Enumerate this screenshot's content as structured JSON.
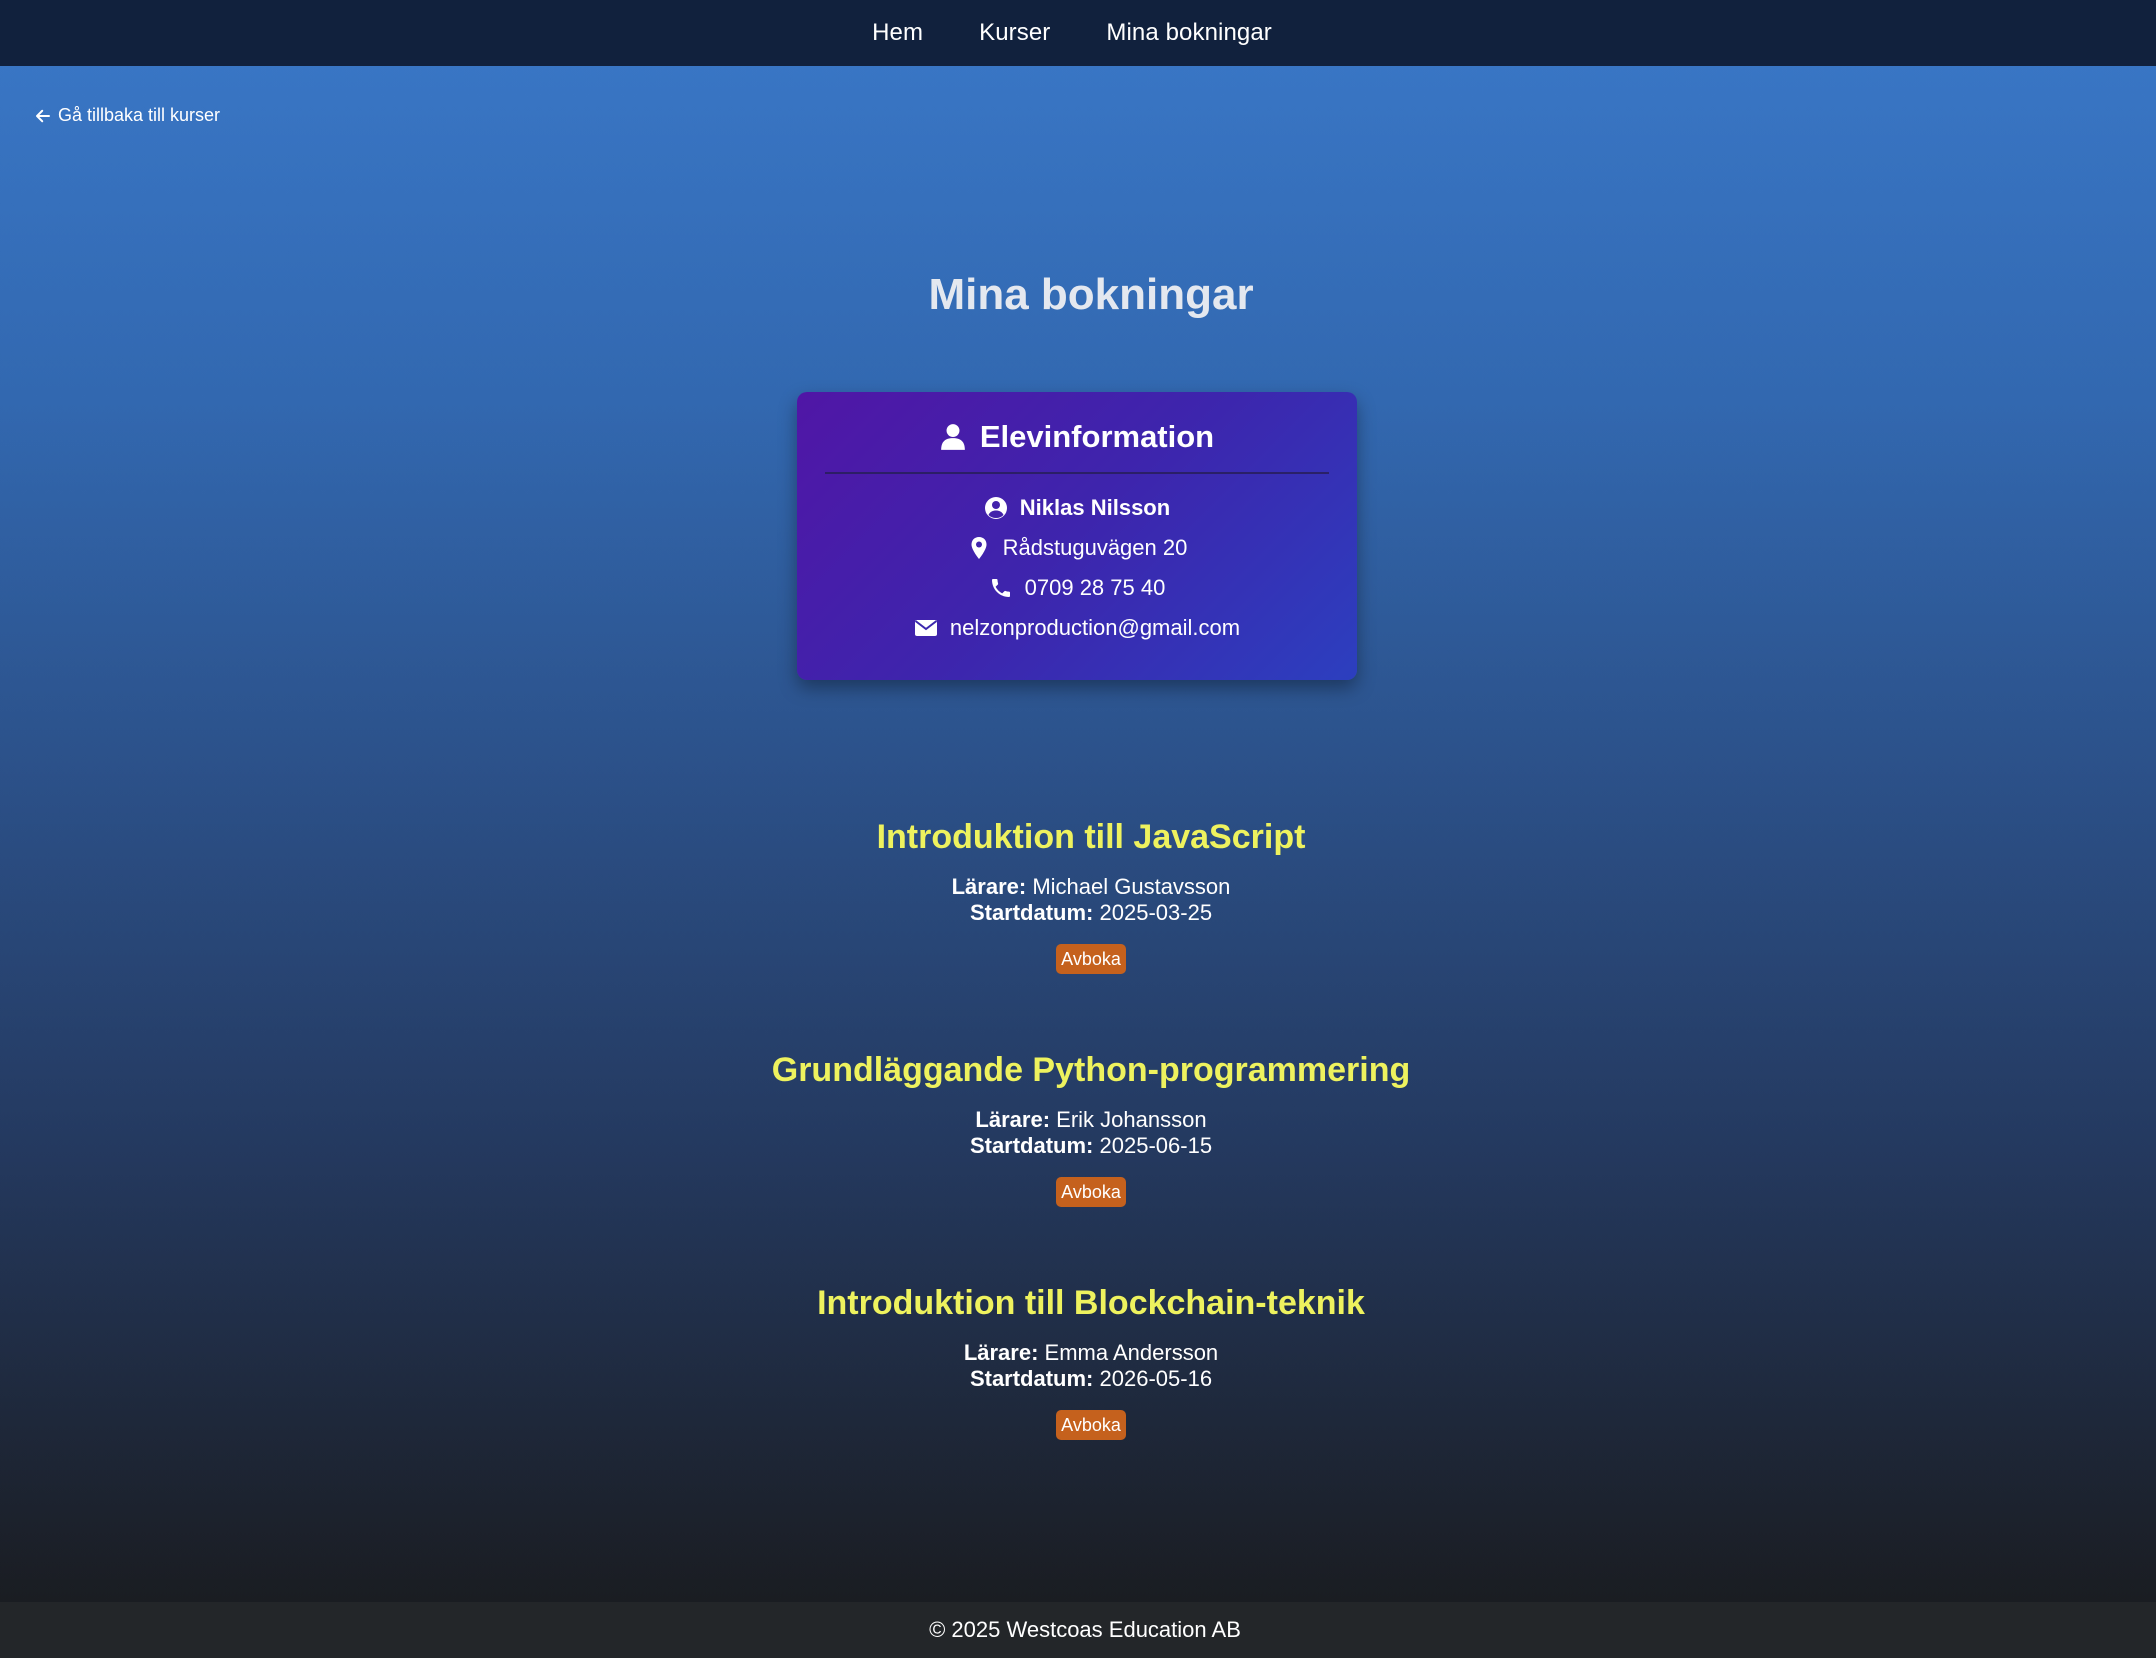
{
  "nav": {
    "items": [
      {
        "label": "Hem"
      },
      {
        "label": "Kurser"
      },
      {
        "label": "Mina bokningar"
      }
    ]
  },
  "back_link": {
    "label": "Gå tillbaka till kurser",
    "icon": "arrow-left-icon"
  },
  "page_title": "Mina bokningar",
  "student": {
    "heading": "Elevinformation",
    "name": "Niklas Nilsson",
    "address": "Rådstuguvägen 20",
    "phone": "0709 28 75 40",
    "email": "nelzonproduction@gmail.com"
  },
  "labels": {
    "teacher": "Lärare:",
    "start_date": "Startdatum:",
    "cancel": "Avboka"
  },
  "bookings": [
    {
      "title": "Introduktion till JavaScript",
      "teacher": "Michael Gustavsson",
      "start_date": "2025-03-25"
    },
    {
      "title": "Grundläggande Python-programmering",
      "teacher": "Erik Johansson",
      "start_date": "2025-06-15"
    },
    {
      "title": "Introduktion till Blockchain-teknik",
      "teacher": "Emma Andersson",
      "start_date": "2026-05-16"
    }
  ],
  "footer": {
    "text": "© 2025 Westcoas Education AB"
  },
  "colors": {
    "nav_bg": "#11213d",
    "course_title": "#eef25e",
    "cancel_button": "#c5611d",
    "footer_bg": "#232629"
  }
}
